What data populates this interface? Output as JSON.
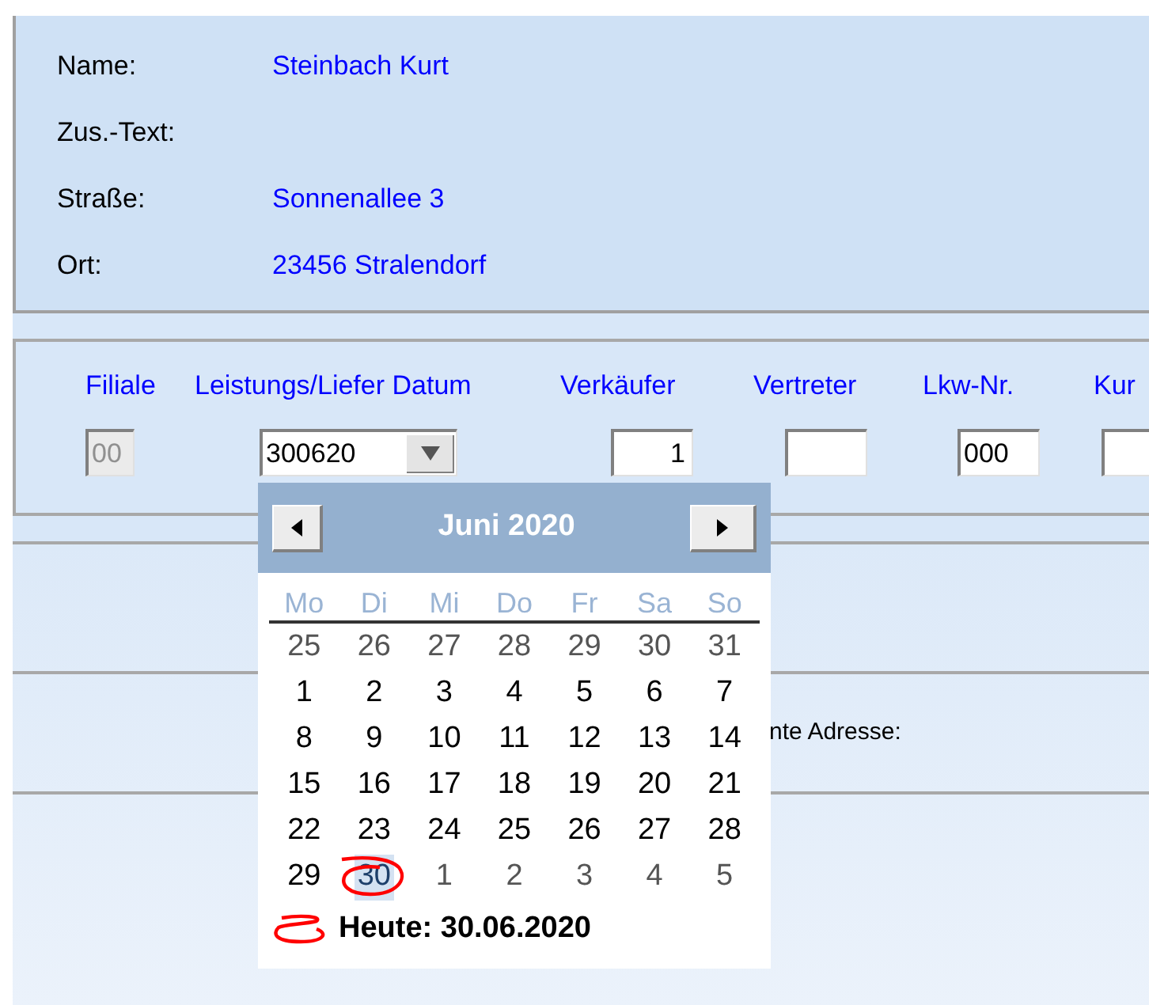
{
  "customer": [
    {
      "label": "Name:",
      "value": "Steinbach Kurt"
    },
    {
      "label": "Zus.-Text:"
    },
    {
      "label": "Straße:",
      "value": "Sonnenallee 3"
    },
    {
      "label": "Ort:",
      "value": "23456 Stralendorf"
    }
  ],
  "fields": [
    {
      "label": "Filiale",
      "value": "00",
      "kind": "text",
      "disabled": true
    },
    {
      "label": "Leistungs/Liefer Datum",
      "value": "300620",
      "kind": "date",
      "disabled": false
    },
    {
      "label": "Verkäufer",
      "value": "1",
      "kind": "number",
      "disabled": false
    },
    {
      "label": "Vertreter",
      "kind": "text",
      "disabled": false
    },
    {
      "label": "Lkw-Nr.",
      "value": "000",
      "kind": "text",
      "disabled": false
    },
    {
      "label": "Kur",
      "kind": "text",
      "disabled": false
    }
  ],
  "calendar": {
    "title": "Juni 2020",
    "weekdays": [
      "Mo",
      "Di",
      "Mi",
      "Do",
      "Fr",
      "Sa",
      "So"
    ],
    "weeks": [
      [
        {
          "day": "25",
          "outside": true,
          "selected": false
        },
        {
          "day": "26",
          "outside": true,
          "selected": false
        },
        {
          "day": "27",
          "outside": true,
          "selected": false
        },
        {
          "day": "28",
          "outside": true,
          "selected": false
        },
        {
          "day": "29",
          "outside": true,
          "selected": false
        },
        {
          "day": "30",
          "outside": true,
          "selected": false
        },
        {
          "day": "31",
          "outside": true,
          "selected": false
        }
      ],
      [
        {
          "day": "1",
          "outside": false,
          "selected": false
        },
        {
          "day": "2",
          "outside": false,
          "selected": false
        },
        {
          "day": "3",
          "outside": false,
          "selected": false
        },
        {
          "day": "4",
          "outside": false,
          "selected": false
        },
        {
          "day": "5",
          "outside": false,
          "selected": false
        },
        {
          "day": "6",
          "outside": false,
          "selected": false
        },
        {
          "day": "7",
          "outside": false,
          "selected": false
        }
      ],
      [
        {
          "day": "8",
          "outside": false,
          "selected": false
        },
        {
          "day": "9",
          "outside": false,
          "selected": false
        },
        {
          "day": "10",
          "outside": false,
          "selected": false
        },
        {
          "day": "11",
          "outside": false,
          "selected": false
        },
        {
          "day": "12",
          "outside": false,
          "selected": false
        },
        {
          "day": "13",
          "outside": false,
          "selected": false
        },
        {
          "day": "14",
          "outside": false,
          "selected": false
        }
      ],
      [
        {
          "day": "15",
          "outside": false,
          "selected": false
        },
        {
          "day": "16",
          "outside": false,
          "selected": false
        },
        {
          "day": "17",
          "outside": false,
          "selected": false
        },
        {
          "day": "18",
          "outside": false,
          "selected": false
        },
        {
          "day": "19",
          "outside": false,
          "selected": false
        },
        {
          "day": "20",
          "outside": false,
          "selected": false
        },
        {
          "day": "21",
          "outside": false,
          "selected": false
        }
      ],
      [
        {
          "day": "22",
          "outside": false,
          "selected": false
        },
        {
          "day": "23",
          "outside": false,
          "selected": false
        },
        {
          "day": "24",
          "outside": false,
          "selected": false
        },
        {
          "day": "25",
          "outside": false,
          "selected": false
        },
        {
          "day": "26",
          "outside": false,
          "selected": false
        },
        {
          "day": "27",
          "outside": false,
          "selected": false
        },
        {
          "day": "28",
          "outside": false,
          "selected": false
        }
      ],
      [
        {
          "day": "29",
          "outside": false,
          "selected": false
        },
        {
          "day": "30",
          "outside": false,
          "selected": true
        },
        {
          "day": "1",
          "outside": true,
          "selected": false
        },
        {
          "day": "2",
          "outside": true,
          "selected": false
        },
        {
          "day": "3",
          "outside": true,
          "selected": false
        },
        {
          "day": "4",
          "outside": true,
          "selected": false
        },
        {
          "day": "5",
          "outside": true,
          "selected": false
        }
      ]
    ],
    "today": "Heute: 30.06.2020"
  },
  "address_label": "nte Adresse:"
}
